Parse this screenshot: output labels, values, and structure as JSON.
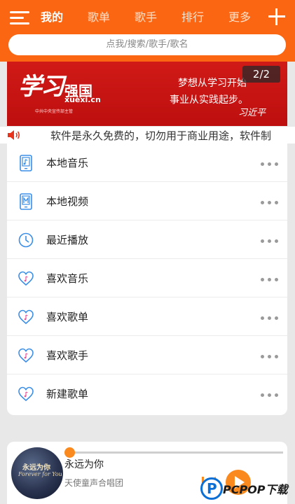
{
  "header": {
    "tabs": [
      {
        "label": "我的",
        "active": true
      },
      {
        "label": "歌单",
        "active": false
      },
      {
        "label": "歌手",
        "active": false
      },
      {
        "label": "排行",
        "active": false
      },
      {
        "label": "更多",
        "active": false
      }
    ],
    "search_placeholder": "点我/搜索/歌手/歌名",
    "accent_color": "#fb6612"
  },
  "banner": {
    "logo_script": "学习",
    "logo_name": "强国",
    "logo_url": "xuexi.cn",
    "logo_sub": "中共中央宣传部主管",
    "slogan_line1": "梦想从学习开始",
    "slogan_line2": "事业从实践起步。",
    "signature": "习近平",
    "indicator": "2/2"
  },
  "marquee": {
    "icon": "speaker-icon",
    "text": "软件是永久免费的，切勿用于商业用途，软件制"
  },
  "menu": [
    {
      "label": "本地音乐",
      "icon": "music-file-icon"
    },
    {
      "label": "本地视频",
      "icon": "video-file-icon"
    },
    {
      "label": "最近播放",
      "icon": "clock-icon"
    },
    {
      "label": "喜欢音乐",
      "icon": "heart-music-icon"
    },
    {
      "label": "喜欢歌单",
      "icon": "heart-music-icon"
    },
    {
      "label": "喜欢歌手",
      "icon": "heart-music-icon"
    },
    {
      "label": "新建歌单",
      "icon": "heart-music-icon"
    }
  ],
  "player": {
    "album_line1": "永远为你",
    "album_line2": "Forever for You",
    "title": "永远为你",
    "artist": "天使童声合唱团",
    "progress": 0.0
  },
  "watermark": {
    "text": "PCPOP下载"
  }
}
